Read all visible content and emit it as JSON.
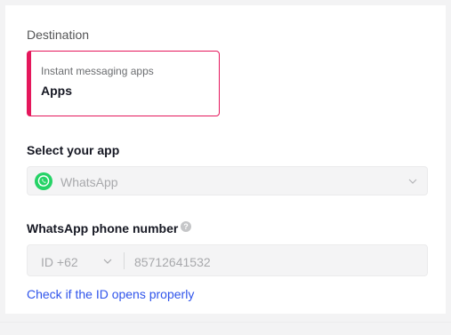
{
  "destination": {
    "label": "Destination",
    "card_subtitle": "Instant messaging apps",
    "card_title": "Apps"
  },
  "app_select": {
    "label": "Select your app",
    "value": "WhatsApp",
    "icon": "whatsapp-icon"
  },
  "phone": {
    "label": "WhatsApp phone number",
    "country_code": "ID +62",
    "number": "85712641532"
  },
  "check_link": "Check if the ID opens properly",
  "colors": {
    "accent": "#e5175c",
    "link": "#2f54eb",
    "whatsapp": "#25d366"
  }
}
